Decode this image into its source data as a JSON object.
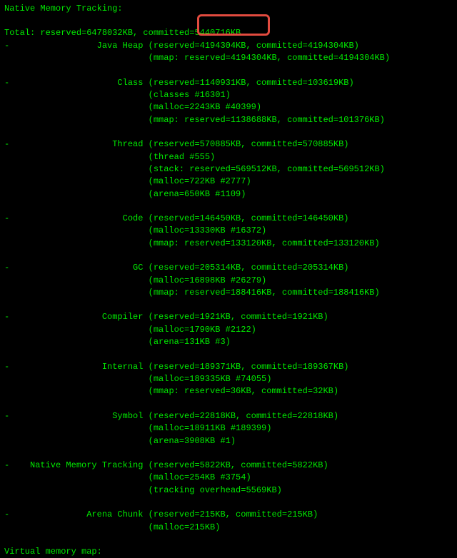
{
  "title": "Native Memory Tracking:",
  "total": "Total: reserved=6478032KB, committed=5440716KB",
  "sections": [
    {
      "name": "Java Heap",
      "main": "-                 Java Heap (reserved=4194304KB, committed=4194304KB)",
      "sub": [
        "                            (mmap: reserved=4194304KB, committed=4194304KB)"
      ]
    },
    {
      "name": "Class",
      "main": "-                     Class (reserved=1140931KB, committed=103619KB)",
      "sub": [
        "                            (classes #16301)",
        "                            (malloc=2243KB #40399)",
        "                            (mmap: reserved=1138688KB, committed=101376KB)"
      ]
    },
    {
      "name": "Thread",
      "main": "-                    Thread (reserved=570885KB, committed=570885KB)",
      "sub": [
        "                            (thread #555)",
        "                            (stack: reserved=569512KB, committed=569512KB)",
        "                            (malloc=722KB #2777)",
        "                            (arena=650KB #1109)"
      ]
    },
    {
      "name": "Code",
      "main": "-                      Code (reserved=146450KB, committed=146450KB)",
      "sub": [
        "                            (malloc=13330KB #16372)",
        "                            (mmap: reserved=133120KB, committed=133120KB)"
      ]
    },
    {
      "name": "GC",
      "main": "-                        GC (reserved=205314KB, committed=205314KB)",
      "sub": [
        "                            (malloc=16898KB #26279)",
        "                            (mmap: reserved=188416KB, committed=188416KB)"
      ]
    },
    {
      "name": "Compiler",
      "main": "-                  Compiler (reserved=1921KB, committed=1921KB)",
      "sub": [
        "                            (malloc=1790KB #2122)",
        "                            (arena=131KB #3)"
      ]
    },
    {
      "name": "Internal",
      "main": "-                  Internal (reserved=189371KB, committed=189367KB)",
      "sub": [
        "                            (malloc=189335KB #74055)",
        "                            (mmap: reserved=36KB, committed=32KB)"
      ]
    },
    {
      "name": "Symbol",
      "main": "-                    Symbol (reserved=22818KB, committed=22818KB)",
      "sub": [
        "                            (malloc=18911KB #189399)",
        "                            (arena=3908KB #1)"
      ]
    },
    {
      "name": "Native Memory Tracking",
      "main": "-    Native Memory Tracking (reserved=5822KB, committed=5822KB)",
      "sub": [
        "                            (malloc=254KB #3754)",
        "                            (tracking overhead=5569KB)"
      ]
    },
    {
      "name": "Arena Chunk",
      "main": "-               Arena Chunk (reserved=215KB, committed=215KB)",
      "sub": [
        "                            (malloc=215KB)"
      ]
    }
  ],
  "footer": "Virtual memory map:",
  "chart_data": {
    "type": "table",
    "title": "Native Memory Tracking",
    "total_reserved_kb": 6478032,
    "total_committed_kb": 5440716,
    "categories": [
      {
        "name": "Java Heap",
        "reserved_kb": 4194304,
        "committed_kb": 4194304,
        "mmap_reserved_kb": 4194304,
        "mmap_committed_kb": 4194304
      },
      {
        "name": "Class",
        "reserved_kb": 1140931,
        "committed_kb": 103619,
        "classes": 16301,
        "malloc_kb": 2243,
        "malloc_count": 40399,
        "mmap_reserved_kb": 1138688,
        "mmap_committed_kb": 101376
      },
      {
        "name": "Thread",
        "reserved_kb": 570885,
        "committed_kb": 570885,
        "thread_count": 555,
        "stack_reserved_kb": 569512,
        "stack_committed_kb": 569512,
        "malloc_kb": 722,
        "malloc_count": 2777,
        "arena_kb": 650,
        "arena_count": 1109
      },
      {
        "name": "Code",
        "reserved_kb": 146450,
        "committed_kb": 146450,
        "malloc_kb": 13330,
        "malloc_count": 16372,
        "mmap_reserved_kb": 133120,
        "mmap_committed_kb": 133120
      },
      {
        "name": "GC",
        "reserved_kb": 205314,
        "committed_kb": 205314,
        "malloc_kb": 16898,
        "malloc_count": 26279,
        "mmap_reserved_kb": 188416,
        "mmap_committed_kb": 188416
      },
      {
        "name": "Compiler",
        "reserved_kb": 1921,
        "committed_kb": 1921,
        "malloc_kb": 1790,
        "malloc_count": 2122,
        "arena_kb": 131,
        "arena_count": 3
      },
      {
        "name": "Internal",
        "reserved_kb": 189371,
        "committed_kb": 189367,
        "malloc_kb": 189335,
        "malloc_count": 74055,
        "mmap_reserved_kb": 36,
        "mmap_committed_kb": 32
      },
      {
        "name": "Symbol",
        "reserved_kb": 22818,
        "committed_kb": 22818,
        "malloc_kb": 18911,
        "malloc_count": 189399,
        "arena_kb": 3908,
        "arena_count": 1
      },
      {
        "name": "Native Memory Tracking",
        "reserved_kb": 5822,
        "committed_kb": 5822,
        "malloc_kb": 254,
        "malloc_count": 3754,
        "tracking_overhead_kb": 5569
      },
      {
        "name": "Arena Chunk",
        "reserved_kb": 215,
        "committed_kb": 215,
        "malloc_kb": 215
      }
    ]
  }
}
